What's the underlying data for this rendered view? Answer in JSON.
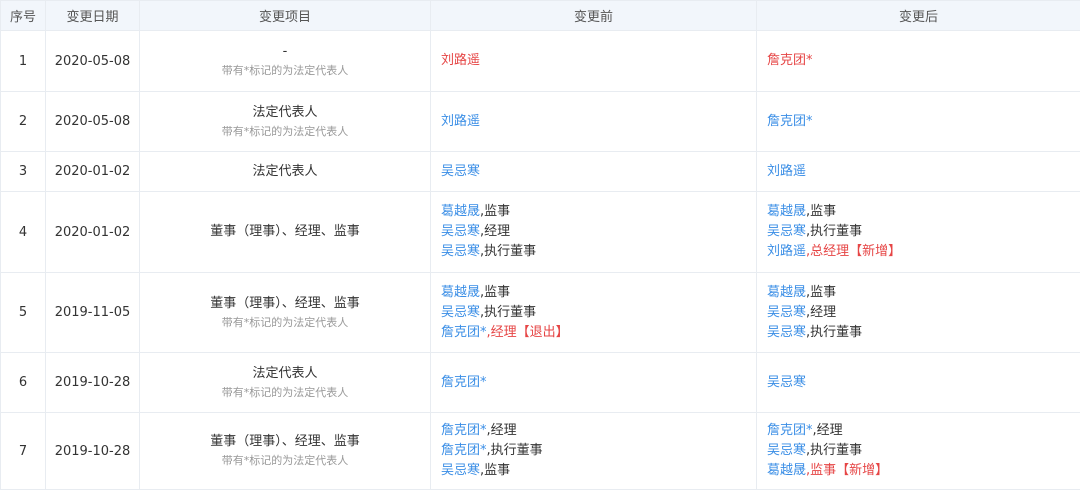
{
  "colors": {
    "link": "#3a8ee6",
    "danger": "#e64545",
    "header_bg": "#f2f6fb",
    "muted": "#999999"
  },
  "headers": {
    "idx": "序号",
    "date": "变更日期",
    "item": "变更项目",
    "before": "变更前",
    "after": "变更后"
  },
  "rows": [
    {
      "idx": "1",
      "date": "2020-05-08",
      "item": "-",
      "note": "带有*标记的为法定代表人",
      "before": [
        [
          {
            "t": "刘路遥",
            "c": "r"
          }
        ]
      ],
      "after": [
        [
          {
            "t": "詹克团*",
            "c": "r"
          }
        ]
      ]
    },
    {
      "idx": "2",
      "date": "2020-05-08",
      "item": "法定代表人",
      "note": "带有*标记的为法定代表人",
      "before": [
        [
          {
            "t": "刘路遥",
            "c": "p"
          }
        ]
      ],
      "after": [
        [
          {
            "t": "詹克团*",
            "c": "p"
          }
        ]
      ]
    },
    {
      "idx": "3",
      "date": "2020-01-02",
      "item": "法定代表人",
      "note": "",
      "before": [
        [
          {
            "t": "吴忌寒",
            "c": "p"
          }
        ]
      ],
      "after": [
        [
          {
            "t": "刘路遥",
            "c": "p"
          }
        ]
      ]
    },
    {
      "idx": "4",
      "date": "2020-01-02",
      "item": "董事（理事）、经理、监事",
      "note": "",
      "before": [
        [
          {
            "t": "葛越晟",
            "c": "p"
          },
          {
            "t": ",监事",
            "c": ""
          }
        ],
        [
          {
            "t": "吴忌寒",
            "c": "p"
          },
          {
            "t": ",经理",
            "c": ""
          }
        ],
        [
          {
            "t": "吴忌寒",
            "c": "p"
          },
          {
            "t": ",执行董事",
            "c": ""
          }
        ]
      ],
      "after": [
        [
          {
            "t": "葛越晟",
            "c": "p"
          },
          {
            "t": ",监事",
            "c": ""
          }
        ],
        [
          {
            "t": "吴忌寒",
            "c": "p"
          },
          {
            "t": ",执行董事",
            "c": ""
          }
        ],
        [
          {
            "t": "刘路遥",
            "c": "p"
          },
          {
            "t": ",总经理【新增】",
            "c": "r"
          }
        ]
      ]
    },
    {
      "idx": "5",
      "date": "2019-11-05",
      "item": "董事（理事）、经理、监事",
      "note": "带有*标记的为法定代表人",
      "before": [
        [
          {
            "t": "葛越晟",
            "c": "p"
          },
          {
            "t": ",监事",
            "c": ""
          }
        ],
        [
          {
            "t": "吴忌寒",
            "c": "p"
          },
          {
            "t": ",执行董事",
            "c": ""
          }
        ],
        [
          {
            "t": "詹克团*",
            "c": "p"
          },
          {
            "t": ",经理【退出】",
            "c": "r"
          }
        ]
      ],
      "after": [
        [
          {
            "t": "葛越晟",
            "c": "p"
          },
          {
            "t": ",监事",
            "c": ""
          }
        ],
        [
          {
            "t": "吴忌寒",
            "c": "p"
          },
          {
            "t": ",经理",
            "c": ""
          }
        ],
        [
          {
            "t": "吴忌寒",
            "c": "p"
          },
          {
            "t": ",执行董事",
            "c": ""
          }
        ]
      ]
    },
    {
      "idx": "6",
      "date": "2019-10-28",
      "item": "法定代表人",
      "note": "带有*标记的为法定代表人",
      "before": [
        [
          {
            "t": "詹克团*",
            "c": "p"
          }
        ]
      ],
      "after": [
        [
          {
            "t": "吴忌寒",
            "c": "p"
          }
        ]
      ]
    },
    {
      "idx": "7",
      "date": "2019-10-28",
      "item": "董事（理事）、经理、监事",
      "note": "带有*标记的为法定代表人",
      "before": [
        [
          {
            "t": "詹克团*",
            "c": "p"
          },
          {
            "t": ",经理",
            "c": ""
          }
        ],
        [
          {
            "t": "詹克团*",
            "c": "p"
          },
          {
            "t": ",执行董事",
            "c": ""
          }
        ],
        [
          {
            "t": "吴忌寒",
            "c": "p"
          },
          {
            "t": ",监事",
            "c": ""
          }
        ]
      ],
      "after": [
        [
          {
            "t": "詹克团*",
            "c": "p"
          },
          {
            "t": ",经理",
            "c": ""
          }
        ],
        [
          {
            "t": "吴忌寒",
            "c": "p"
          },
          {
            "t": ",执行董事",
            "c": ""
          }
        ],
        [
          {
            "t": "葛越晟",
            "c": "p"
          },
          {
            "t": ",监事【新增】",
            "c": "r"
          }
        ]
      ]
    }
  ]
}
